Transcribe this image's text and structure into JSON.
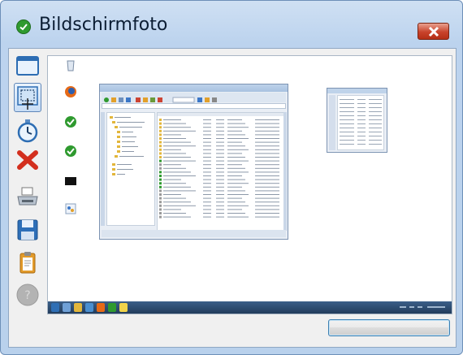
{
  "window": {
    "title": "Bildschirmfoto",
    "accent": "#2f9a2f",
    "close_color": "#c8432b"
  },
  "toolbar": {
    "tools": [
      {
        "icon": "window-capture-icon"
      },
      {
        "icon": "region-capture-icon",
        "selected": true
      },
      {
        "icon": "timer-icon"
      },
      {
        "icon": "delete-icon"
      },
      {
        "icon": "printer-icon"
      },
      {
        "icon": "save-icon"
      },
      {
        "icon": "clipboard-icon"
      },
      {
        "icon": "help-icon",
        "disabled": true
      }
    ]
  },
  "action_button": {
    "label": ""
  }
}
